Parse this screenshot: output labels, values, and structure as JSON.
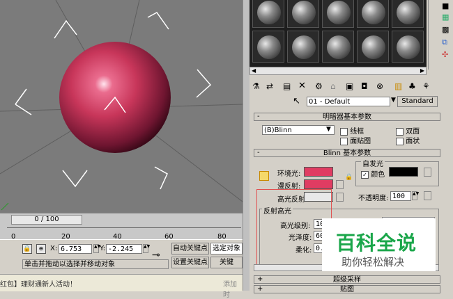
{
  "timeline": {
    "frame_display": "0 / 100",
    "ticks": [
      "0",
      "20",
      "40",
      "60",
      "80"
    ]
  },
  "status": {
    "x_label": "X:",
    "x_value": "6.753",
    "y_label": "Y:",
    "y_value": "-2.245",
    "auto_key": "自动关键点",
    "set_key": "设置关键点",
    "selected_object": "选定对象",
    "key_filter": "关键",
    "prompt": "单击并拖动以选择并移动对象"
  },
  "taskbar": {
    "tab1": "红包】理财通新人活动！",
    "tab2": "添加时"
  },
  "material": {
    "name": "01 - Default",
    "type": "Standard",
    "shader_rollout_title": "明暗器基本参数",
    "shader_type": "(B)Blinn",
    "wire": "线框",
    "two_sided": "双面",
    "face_map": "面贴图",
    "faceted": "面状",
    "blinn_rollout_title": "Blinn 基本参数",
    "self_illum_group": "自发光",
    "self_illum_color_label": "颜色",
    "self_illum_checked": true,
    "ambient": "环境光:",
    "diffuse": "漫反射:",
    "specular": "高光反射:",
    "opacity_label": "不透明度:",
    "opacity_value": "100",
    "spec_highlights_group": "反射高光",
    "spec_level": "高光级别:",
    "spec_level_value": "10",
    "glossiness": "光泽度:",
    "glossiness_value": "60",
    "soften": "柔化:",
    "soften_value": "0.",
    "supersampling_rollout": "超级采样",
    "maps_rollout": "贴图"
  },
  "watermark": {
    "title": "百科全说",
    "subtitle": "助你轻松解决"
  },
  "colors": {
    "sphere": "#c8365a",
    "ambient_swatch": "#e03c62",
    "diffuse_swatch": "#e03c62",
    "specular_swatch": "#e8e8e8",
    "self_illum_swatch": "#000000",
    "watermark_green": "#1aa64a"
  }
}
